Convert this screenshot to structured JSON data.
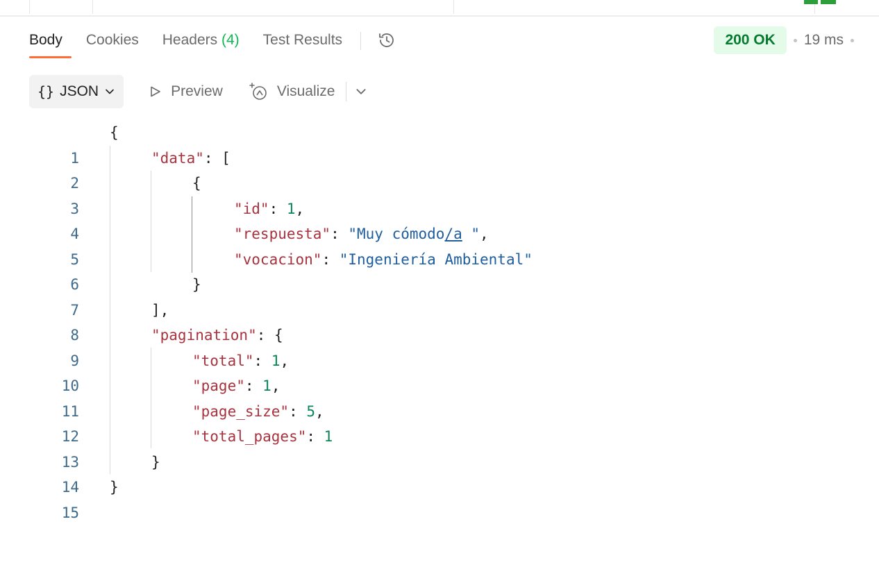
{
  "tabs": [
    {
      "label": "Body"
    },
    {
      "label": "Cookies"
    },
    {
      "label": "Headers",
      "count": "(4)"
    },
    {
      "label": "Test Results"
    }
  ],
  "status": {
    "code": "200 OK",
    "time": "19 ms",
    "color": "#067a2f"
  },
  "toolbar": {
    "format": "JSON",
    "preview": "Preview",
    "visualize": "Visualize"
  },
  "icons": [
    "history-icon",
    "chevron-down-icon",
    "play-outline-icon",
    "sparkle-icon"
  ],
  "code": {
    "line_numbers": [
      "1",
      "2",
      "3",
      "4",
      "5",
      "6",
      "7",
      "8",
      "9",
      "10",
      "11",
      "12",
      "13",
      "14",
      "15"
    ],
    "lines": [
      "{",
      "\"data\": [",
      "{",
      "\"id\": 1,",
      "\"respuesta\": \"Muy cómodo/a \",",
      "\"vocacion\": \"Ingeniería Ambiental\"",
      "}",
      "],",
      "\"pagination\": {",
      "\"total\": 1,",
      "\"page\": 1,",
      "\"page_size\": 5,",
      "\"total_pages\": 1",
      "}",
      "}"
    ],
    "tokens": {
      "brace_open": "{",
      "brace_close": "}",
      "bracket_open": "[",
      "bracket_close_comma": "],",
      "k_data": "\"data\"",
      "k_id": "\"id\"",
      "k_respuesta": "\"respuesta\"",
      "k_vocacion": "\"vocacion\"",
      "k_pagination": "\"pagination\"",
      "k_total": "\"total\"",
      "k_page": "\"page\"",
      "k_page_size": "\"page_size\"",
      "k_total_pages": "\"total_pages\"",
      "v_id": "1",
      "v_respuesta_pre": "\"Muy cómodo",
      "v_respuesta_link": "/a",
      "v_respuesta_post": " \"",
      "v_vocacion": "\"Ingeniería Ambiental\"",
      "v_total": "1",
      "v_page": "1",
      "v_page_size": "5",
      "v_total_pages": "1",
      "colon": ": ",
      "comma": ","
    }
  }
}
